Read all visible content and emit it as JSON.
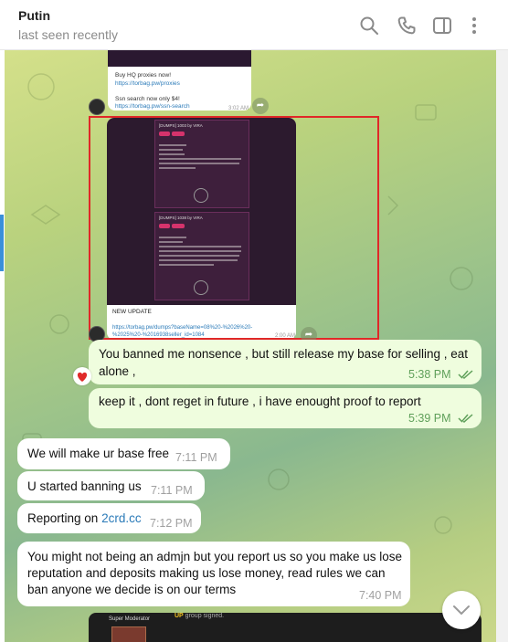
{
  "header": {
    "title": "Putin",
    "status": "last seen recently",
    "icons": [
      "search-icon",
      "phone-icon",
      "sidebar-icon",
      "more-icon"
    ]
  },
  "forwarded_card": {
    "line1": "Buy HQ proxies now!",
    "link1": "https://torbag.pw/proxies",
    "line2": "Ssn search now only $4!",
    "link2": "https://torbag.pw/ssn-search",
    "time": "3:02 AM"
  },
  "update_card": {
    "shot1_title": "[DUMPS] 1003 by VIRA",
    "shot2_title": "[DUMPS] 1038 by VIRA",
    "caption": "NEW UPDATE",
    "link": "https://torbag.pw/dumps?baseName=08%20-%2026%20-%2025%20-%2016938seller_id=1084",
    "time": "2:00 AM"
  },
  "messages": [
    {
      "side": "out",
      "text": "You banned me nonsence , but still release my base for selling , eat alone  ,",
      "time": "5:38 PM",
      "reaction": "heart"
    },
    {
      "side": "out",
      "text": "keep it , dont reget in future , i have enought proof to report",
      "time": "5:39 PM"
    },
    {
      "side": "in",
      "text": "We will make ur base free",
      "time": "7:11 PM"
    },
    {
      "side": "in",
      "text": "U started banning us",
      "time": "7:11 PM"
    },
    {
      "side": "in",
      "text_prefix": "Reporting on ",
      "link": "2crd.cc",
      "time": "7:12 PM"
    },
    {
      "side": "in",
      "text": "You might not being an admjn but you report us so you make us lose reputation and deposits making us lose money, read rules we can ban anyone we decide is on our terms",
      "time": "7:40 PM"
    }
  ],
  "bottom_card": {
    "role": "Super Moderator",
    "prefix": "UP",
    "text": " group signed."
  },
  "colors": {
    "outgoing_bubble": "#effdde",
    "incoming_bubble": "#ffffff",
    "check_color": "#5fa05a",
    "link_color": "#2a7ab8",
    "highlight_border": "#e02828"
  }
}
